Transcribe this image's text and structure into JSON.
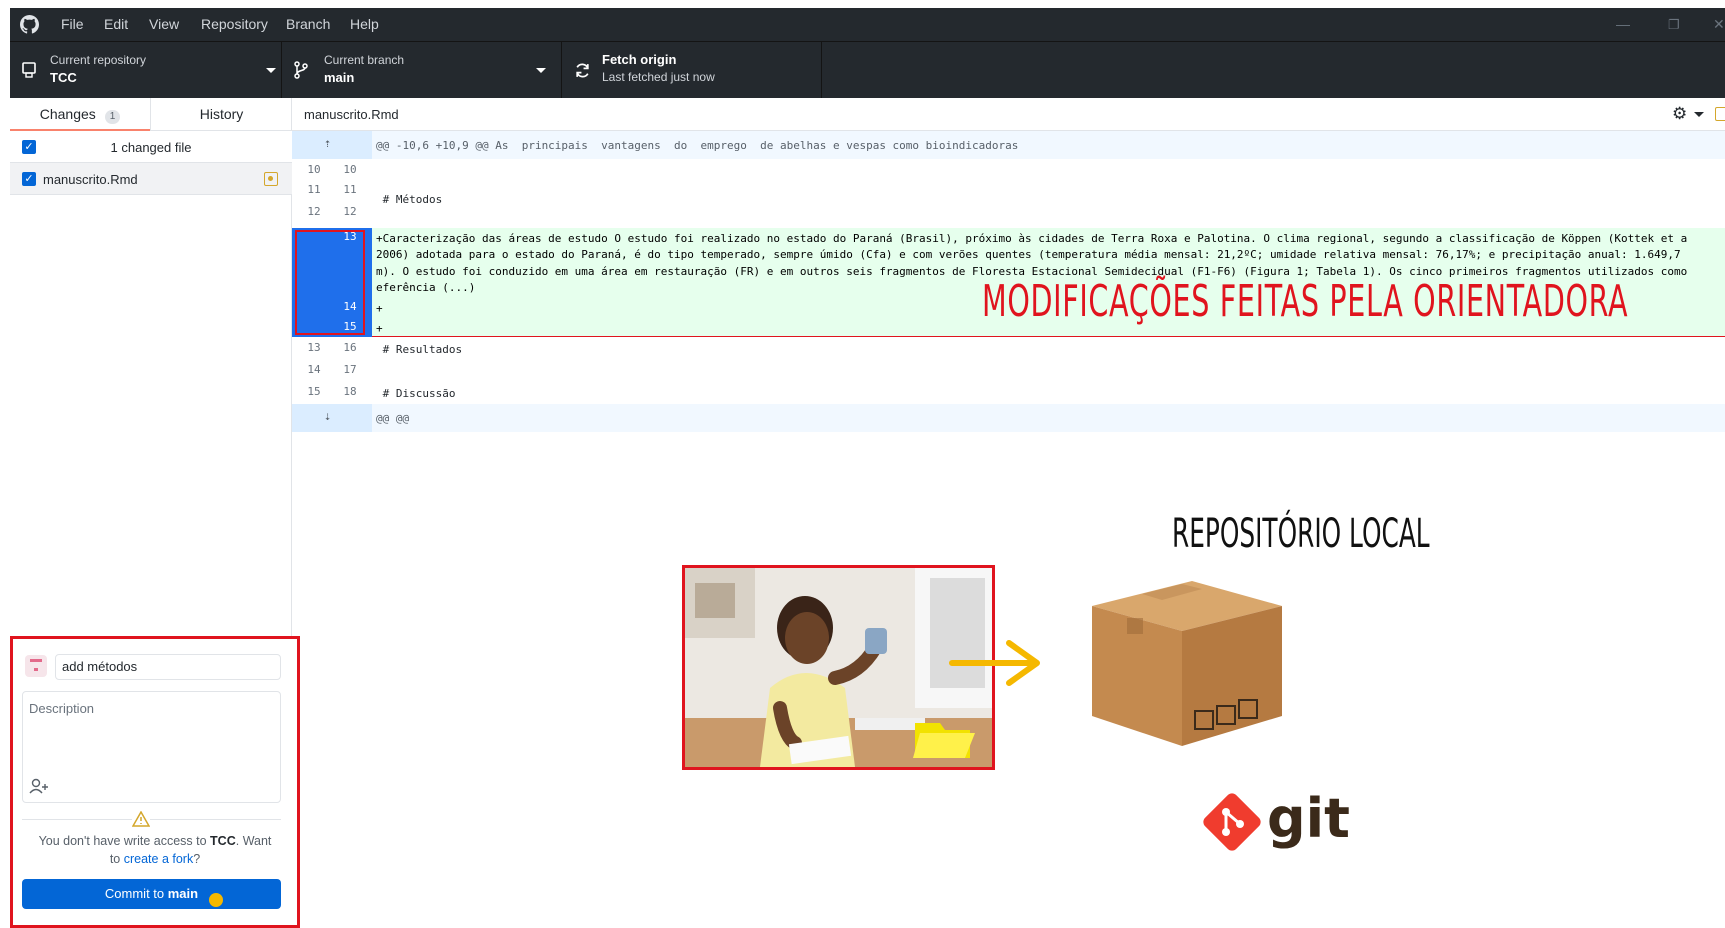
{
  "menu": [
    "File",
    "Edit",
    "View",
    "Repository",
    "Branch",
    "Help"
  ],
  "toolbar": {
    "repo_label": "Current repository",
    "repo_name": "TCC",
    "branch_label": "Current branch",
    "branch_name": "main",
    "fetch_title": "Fetch origin",
    "fetch_status": "Last fetched just now"
  },
  "tabs": {
    "changes_label": "Changes",
    "changes_count": "1",
    "history_label": "History"
  },
  "changes": {
    "summary": "1 changed file",
    "files": [
      {
        "name": "manuscrito.Rmd"
      }
    ]
  },
  "diff": {
    "file_name": "manuscrito.Rmd",
    "hunk_header": "@@ -10,6 +10,9 @@ As  principais  vantagens  do  emprego  de abelhas e vespas como bioindicadoras",
    "footer_header": "@@ @@",
    "rows": [
      {
        "old": "10",
        "new": "10",
        "text": ""
      },
      {
        "old": "11",
        "new": "11",
        "text": " # Métodos"
      },
      {
        "old": "12",
        "new": "12",
        "text": ""
      },
      {
        "old": "",
        "new": "13",
        "text": "+Caracterização das áreas de estudo O estudo foi realizado no estado do Paraná (Brasil), próximo às cidades de Terra Roxa e Palotina. O clima regional, segundo a classificação de Köppen (Kottek et a"
      },
      {
        "old": "",
        "new": "",
        "text": "2006) adotada para o estado do Paraná, é do tipo temperado, sempre úmido (Cfa) e com verões quentes (temperatura média mensal: 21,2ºC; umidade relativa mensal: 76,17%; e precipitação anual: 1.649,7"
      },
      {
        "old": "",
        "new": "",
        "text": "m). O estudo foi conduzido em uma área em restauração (FR) e em outros seis fragmentos de Floresta Estacional Semidecidual (F1-F6) (Figura 1; Tabela 1). Os cinco primeiros fragmentos utilizados como"
      },
      {
        "old": "",
        "new": "",
        "text": "eferência (...)"
      },
      {
        "old": "",
        "new": "14",
        "text": "+"
      },
      {
        "old": "",
        "new": "15",
        "text": "+"
      },
      {
        "old": "13",
        "new": "16",
        "text": " # Resultados"
      },
      {
        "old": "14",
        "new": "17",
        "text": ""
      },
      {
        "old": "15",
        "new": "18",
        "text": " # Discussão"
      }
    ]
  },
  "annotations": {
    "modifications": "MODIFICAÇÕES FEITAS PELA ORIENTADORA",
    "local_repo": "REPOSITÓRIO LOCAL",
    "git_word": "git"
  },
  "commit": {
    "summary_value": "add métodos",
    "description_placeholder": "Description",
    "warning_prefix": "You don't have write access to ",
    "warning_repo": "TCC",
    "warning_suffix": ". Want",
    "warning_line2_prefix": "to ",
    "fork_link": "create a fork",
    "warning_line2_suffix": "?",
    "button_prefix": "Commit to ",
    "button_branch": "main"
  },
  "colors": {
    "titlebar": "#24292e",
    "accent_blue": "#0366d6",
    "added_bg": "#e6ffed",
    "annotation_red": "#e0141e",
    "arrow_yellow": "#f5b800",
    "git_orange": "#f03c2e"
  }
}
